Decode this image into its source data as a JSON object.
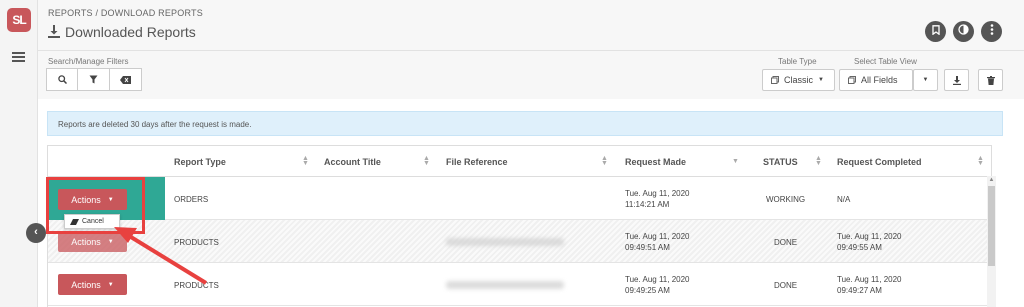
{
  "app": {
    "logo_text": "SL",
    "accent_color": "#c8575b",
    "teal_color": "#2fa895"
  },
  "header": {
    "breadcrumb": "REPORTS / DOWNLOAD REPORTS",
    "title": "Downloaded Reports",
    "title_icon": "download-icon",
    "buttons": [
      {
        "name": "bookmark-button",
        "icon": "bookmark-icon"
      },
      {
        "name": "theme-toggle-button",
        "icon": "contrast-icon"
      },
      {
        "name": "more-options-button",
        "icon": "kebab-icon"
      }
    ]
  },
  "toolbar": {
    "filters_label": "Search/Manage Filters",
    "filter_buttons": [
      "search-icon",
      "filter-icon",
      "clear-filter-icon"
    ],
    "table_type_label": "Table Type",
    "table_type_value": "Classic",
    "table_view_label": "Select Table View",
    "table_view_value": "All Fields"
  },
  "notice": "Reports are deleted 30 days after the request is made.",
  "table": {
    "columns": [
      "Report Type",
      "Account Title",
      "File Reference",
      "Request Made",
      "STATUS",
      "Request Completed"
    ],
    "rows": [
      {
        "type": "ORDERS",
        "made_date": "Tue. Aug 11, 2020",
        "made_time": "11:14:21 AM",
        "status": "WORKING",
        "completed": "N/A"
      },
      {
        "type": "PRODUCTS",
        "made_date": "Tue. Aug 11, 2020",
        "made_time": "09:49:51 AM",
        "status": "DONE",
        "completed_date": "Tue. Aug 11, 2020",
        "completed_time": "09:49:55 AM"
      },
      {
        "type": "PRODUCTS",
        "made_date": "Tue. Aug 11, 2020",
        "made_time": "09:49:25 AM",
        "status": "DONE",
        "completed_date": "Tue. Aug 11, 2020",
        "completed_time": "09:49:27 AM"
      }
    ],
    "actions_label": "Actions",
    "dropdown_item": "Cancel"
  },
  "annotation_color": "#e8413f"
}
